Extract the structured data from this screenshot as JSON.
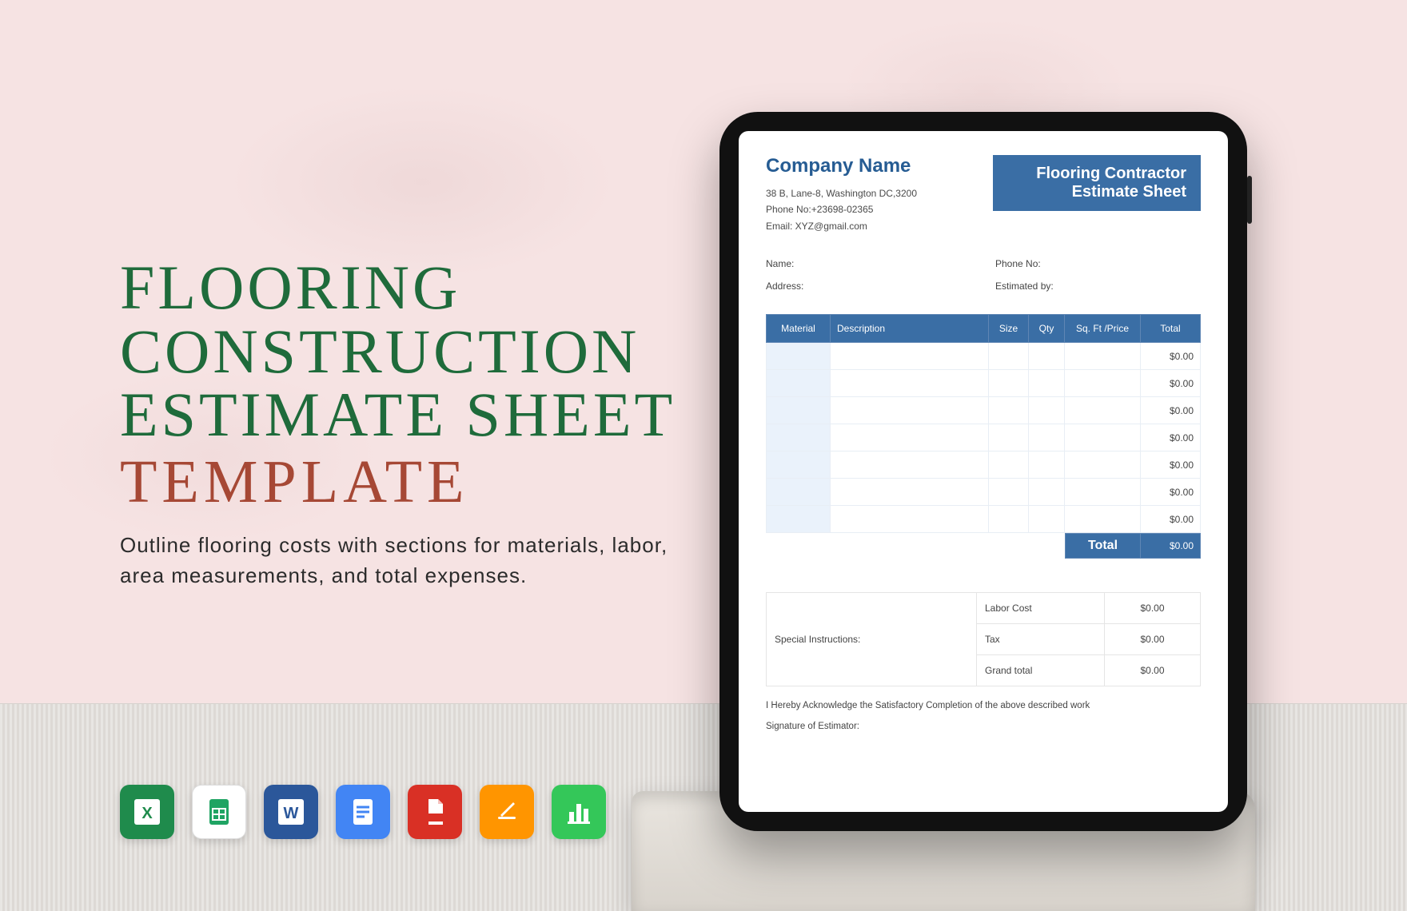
{
  "promo": {
    "line1": "FLOORING",
    "line2": "CONSTRUCTION",
    "line3": "ESTIMATE SHEET",
    "template_word": "TEMPLATE",
    "subtitle": "Outline flooring costs with sections for materials, labor, area measurements, and total expenses."
  },
  "app_icons": [
    {
      "name": "excel-icon"
    },
    {
      "name": "google-sheets-icon"
    },
    {
      "name": "word-icon"
    },
    {
      "name": "google-docs-icon"
    },
    {
      "name": "pdf-icon"
    },
    {
      "name": "pages-icon"
    },
    {
      "name": "numbers-icon"
    }
  ],
  "doc": {
    "company_name": "Company Name",
    "address": "38 B, Lane-8, Washington DC,3200",
    "phone_line": "Phone No:+23698-02365",
    "email_line": "Email: XYZ@gmail.com",
    "badge_line1": "Flooring Contractor",
    "badge_line2": "Estimate Sheet",
    "fields": {
      "name": "Name:",
      "phone": "Phone No:",
      "address": "Address:",
      "estimated_by": "Estimated by:"
    },
    "table": {
      "headers": {
        "material": "Material",
        "description": "Description",
        "size": "Size",
        "qty": "Qty",
        "sqft_price": "Sq. Ft /Price",
        "total": "Total"
      },
      "rows": [
        {
          "total": "$0.00"
        },
        {
          "total": "$0.00"
        },
        {
          "total": "$0.00"
        },
        {
          "total": "$0.00"
        },
        {
          "total": "$0.00"
        },
        {
          "total": "$0.00"
        },
        {
          "total": "$0.00"
        }
      ],
      "total_label": "Total",
      "total_value": "$0.00"
    },
    "summary": {
      "special_instructions": "Special Instructions:",
      "labor_cost": {
        "label": "Labor Cost",
        "value": "$0.00"
      },
      "tax": {
        "label": "Tax",
        "value": "$0.00"
      },
      "grand_total": {
        "label": "Grand total",
        "value": "$0.00"
      }
    },
    "acknowledgement": "I Hereby Acknowledge the Satisfactory Completion of the above described work",
    "signature": "Signature of Estimator:"
  }
}
